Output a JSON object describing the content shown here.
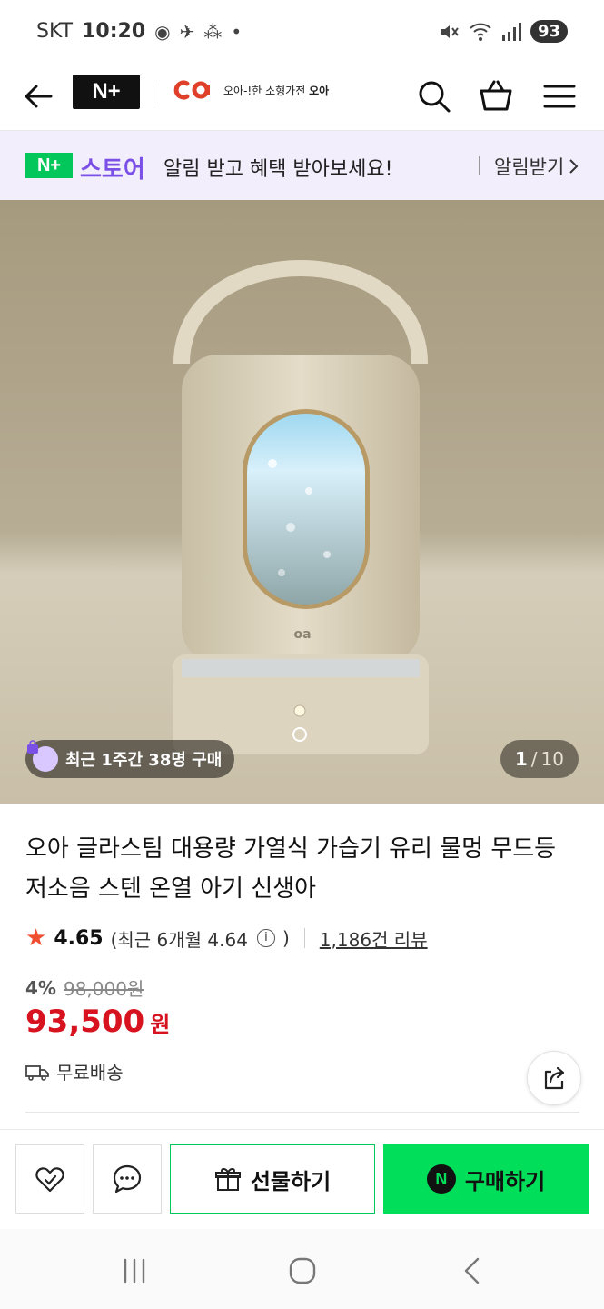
{
  "status_bar": {
    "carrier": "SKT",
    "time": "10:20",
    "battery": "93",
    "left_icons": [
      "record-icon",
      "app-icon",
      "grid-icon",
      "dot-icon"
    ],
    "right_icons": [
      "mute-icon",
      "wifi-icon",
      "signal-icon"
    ]
  },
  "header": {
    "brand_logo": "N+",
    "store_name_prefix": "오아-!한 소형가전",
    "store_name": "오아",
    "icons": [
      "back-arrow-icon",
      "search-icon",
      "cart-icon",
      "menu-icon"
    ]
  },
  "notice": {
    "badge": "N+",
    "store_label": "스토어",
    "message": "알림 받고 혜택 받아보세요!",
    "action": "알림받기"
  },
  "gallery": {
    "buyers_badge": "최근 1주간 38명 구매",
    "current_page": "1",
    "separator": "/",
    "total_pages": "10"
  },
  "product": {
    "title": "오아 글라스팀 대용량 가열식 가습기 유리 물멍 무드등 저소음 스텐 온열 아기 신생아",
    "rating": "4.65",
    "recent_rating": "(최근 6개월 4.64",
    "recent_rating_close": ")",
    "review_count": "1,186건 리뷰",
    "discount_rate": "4%",
    "original_price": "98,000원",
    "price": "93,500",
    "price_unit": "원",
    "shipping": "무료배송"
  },
  "actions": {
    "gift_label": "선물하기",
    "buy_label": "구매하기",
    "buy_badge": "N"
  },
  "colors": {
    "naver_green": "#03c75a",
    "buy_green": "#00de5a",
    "price_red": "#d7131f",
    "store_purple": "#7b50e6",
    "star": "#f04e31"
  }
}
